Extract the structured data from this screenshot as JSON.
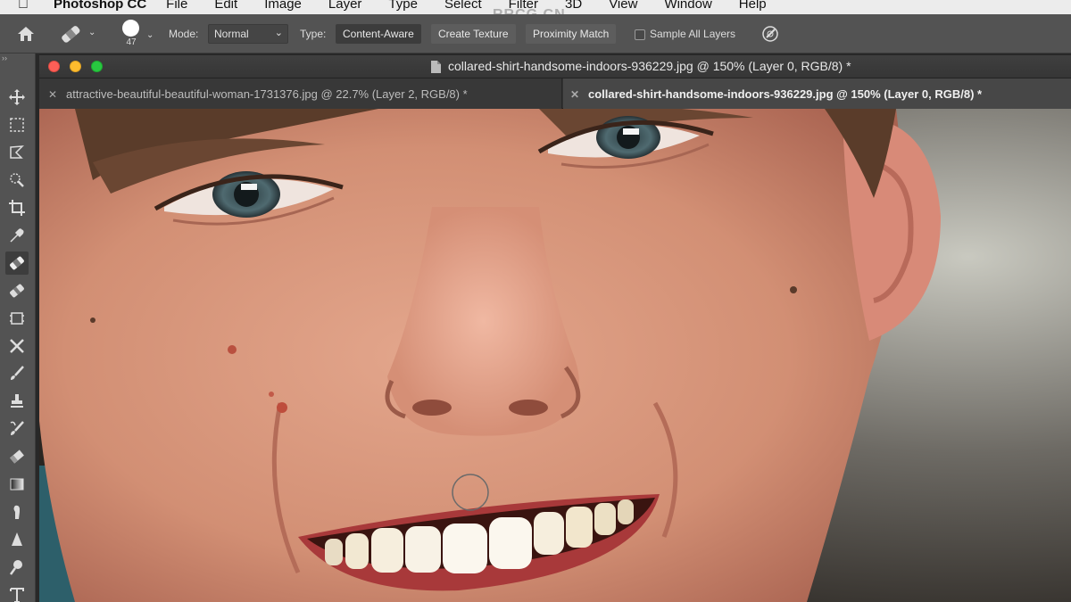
{
  "menubar": {
    "app_name": "Photoshop CC",
    "items": [
      "File",
      "Edit",
      "Image",
      "Layer",
      "Type",
      "Select",
      "Filter",
      "3D",
      "View",
      "Window",
      "Help"
    ],
    "watermark": "RRCG.CN"
  },
  "options_bar": {
    "brush_size": "47",
    "mode_label": "Mode:",
    "mode_value": "Normal",
    "type_label": "Type:",
    "type_options": [
      "Content-Aware",
      "Create Texture",
      "Proximity Match"
    ],
    "selected_type": "Content-Aware",
    "sample_all_layers_label": "Sample All Layers",
    "sample_all_layers_checked": false
  },
  "toolbar": {
    "selected_tool": "spot-healing-brush",
    "tools": [
      "move",
      "rectangular-marquee",
      "lasso",
      "quick-selection",
      "crop",
      "eyedropper",
      "spot-healing-brush",
      "healing-brush",
      "patch",
      "content-aware-move",
      "brush",
      "clone-stamp",
      "history-brush",
      "eraser",
      "gradient",
      "smudge",
      "sharpen",
      "dodge",
      "type"
    ]
  },
  "document": {
    "window_title": "collared-shirt-handsome-indoors-936229.jpg @ 150% (Layer 0, RGB/8) *",
    "tabs": [
      {
        "label": "attractive-beautiful-beautiful-woman-1731376.jpg @ 22.7% (Layer 2, RGB/8) *",
        "active": false
      },
      {
        "label": "collared-shirt-handsome-indoors-936229.jpg @ 150% (Layer 0, RGB/8) *",
        "active": true
      }
    ]
  },
  "colors": {
    "traffic_red": "#fd5f57",
    "traffic_yellow": "#febc2e",
    "traffic_green": "#28c840",
    "panel": "#535353",
    "skin": "#d99a80"
  }
}
